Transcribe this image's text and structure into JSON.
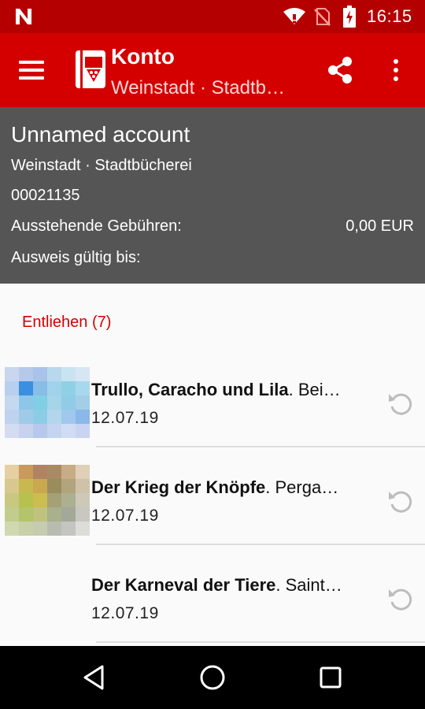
{
  "status_bar": {
    "time": "16:15",
    "icons": [
      "notification-n-icon",
      "wifi-icon",
      "no-sim-icon",
      "battery-charging-icon"
    ]
  },
  "app_bar": {
    "title": "Konto",
    "subtitle": "Weinstadt · Stadtb…",
    "icons": [
      "menu-icon",
      "library-app-icon",
      "share-icon",
      "more-vert-icon"
    ]
  },
  "account": {
    "name": "Unnamed account",
    "library": "Weinstadt · Stadtbücherei",
    "number": "00021135",
    "fees_label": "Ausstehende Gebühren:",
    "fees_value": "0,00 EUR",
    "valid_label": "Ausweis gültig bis:"
  },
  "loans": {
    "header": "Entliehen (7)",
    "items": [
      {
        "title": "Trullo, Caracho und Lila",
        "author": ". Bei…",
        "date": "12.07.19",
        "has_cover": true
      },
      {
        "title": "Der Krieg der Knöpfe",
        "author": ". Perga…",
        "date": "12.07.19",
        "has_cover": true
      },
      {
        "title": "Der Karneval der Tiere",
        "author": ". Saint…",
        "date": "12.07.19",
        "has_cover": false
      }
    ]
  },
  "colors": {
    "status_bar": "#b50000",
    "app_bar": "#d40000",
    "account_bg": "#555555",
    "accent_text": "#d40000"
  },
  "nav_bar": {
    "icons": [
      "back-icon",
      "home-icon",
      "recents-icon"
    ]
  }
}
